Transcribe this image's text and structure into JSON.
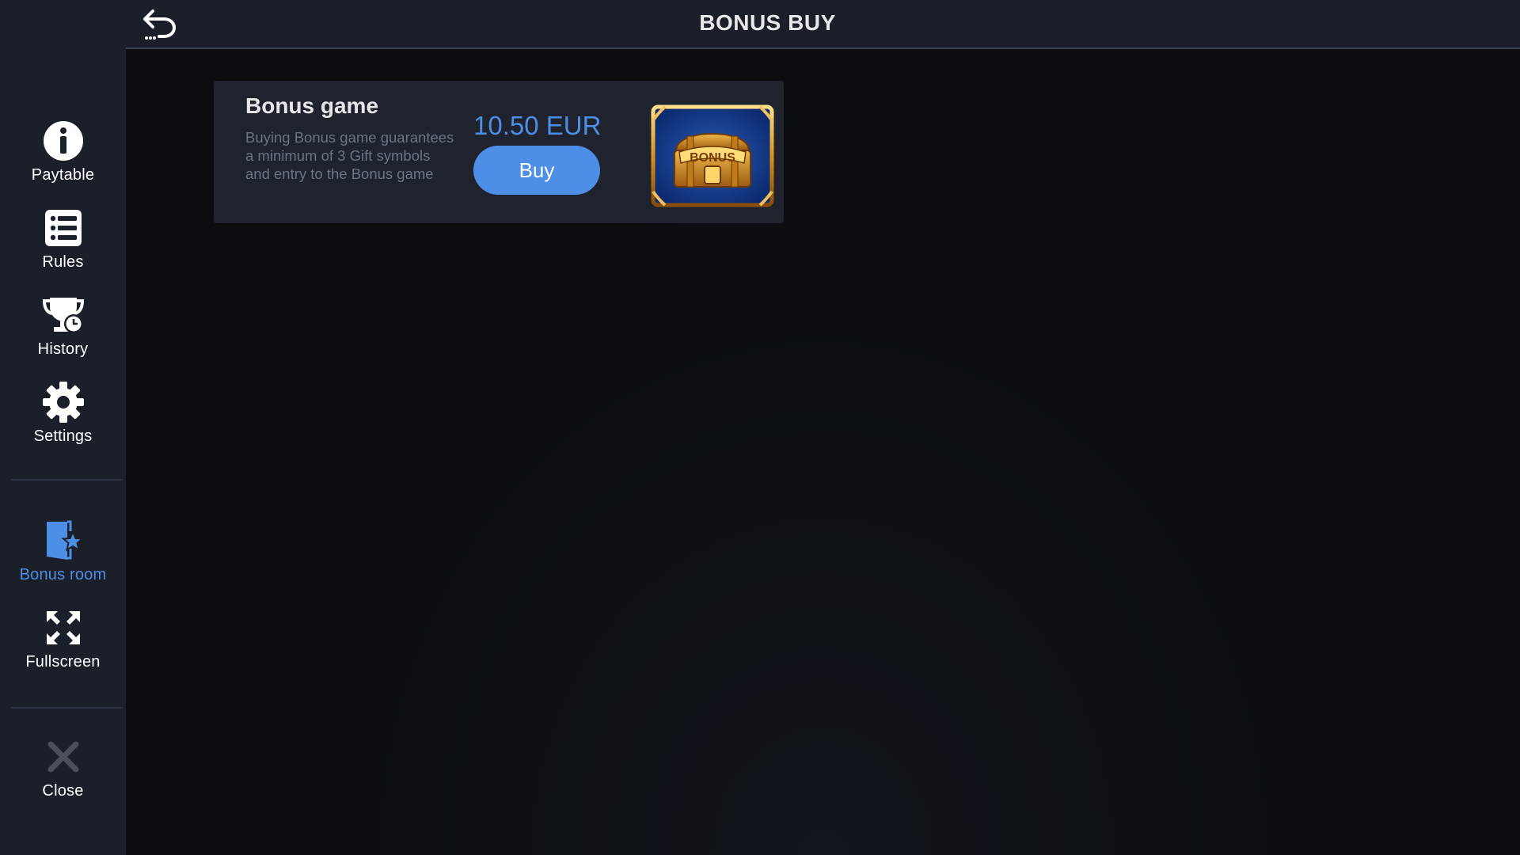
{
  "header": {
    "title": "BONUS BUY",
    "back_icon": "undo-arrow-icon"
  },
  "sidebar": {
    "items": [
      {
        "label": "Paytable",
        "icon": "info-icon"
      },
      {
        "label": "Rules",
        "icon": "list-icon"
      },
      {
        "label": "History",
        "icon": "trophy-clock-icon"
      },
      {
        "label": "Settings",
        "icon": "gear-icon"
      },
      {
        "label": "Bonus room",
        "icon": "door-star-icon",
        "active": true
      },
      {
        "label": "Fullscreen",
        "icon": "expand-icon"
      }
    ],
    "close": {
      "label": "Close",
      "icon": "close-icon"
    }
  },
  "bonus_card": {
    "title": "Bonus game",
    "description": "Buying Bonus game guarantees a minimum of 3 Gift symbols and entry to the Bonus game",
    "price": "10.50 EUR",
    "buy_label": "Buy",
    "image_icon": "bonus-chest-icon",
    "image_text": "BONUS"
  },
  "colors": {
    "accent": "#4d8ee6",
    "sidebar_bg": "#1b1f2a",
    "content_bg": "#0b0d11",
    "card_bg": "#1f232d"
  }
}
